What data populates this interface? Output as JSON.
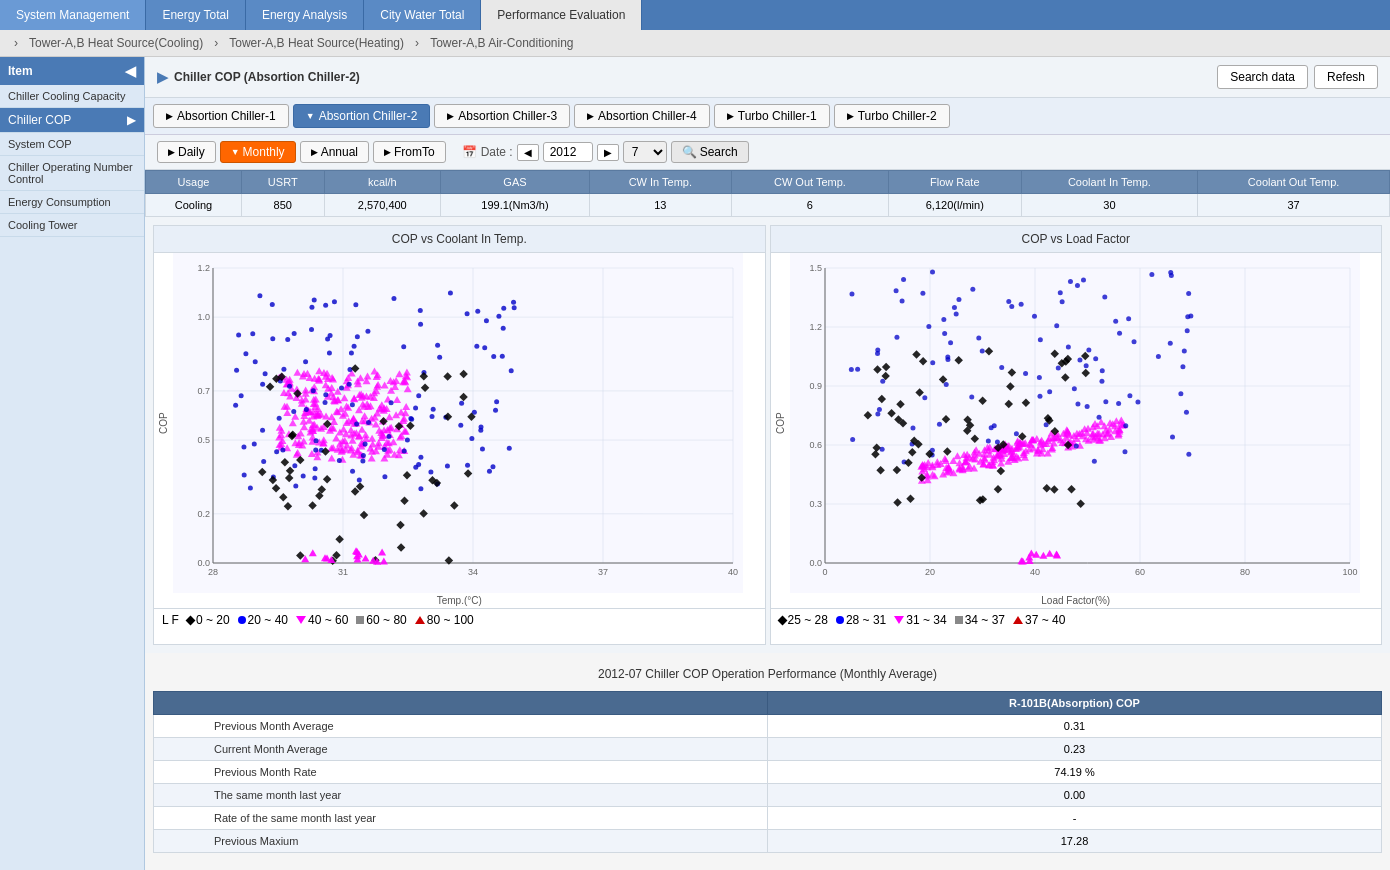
{
  "topNav": {
    "items": [
      {
        "label": "System Management",
        "active": false
      },
      {
        "label": "Energy Total",
        "active": false
      },
      {
        "label": "Energy Analysis",
        "active": false
      },
      {
        "label": "City Water Total",
        "active": false
      },
      {
        "label": "Performance Evaluation",
        "active": true
      }
    ]
  },
  "breadcrumb": {
    "items": [
      "Tower-A,B Heat Source(Cooling)",
      "Tower-A,B Heat Source(Heating)",
      "Tower-A,B Air-Conditioning"
    ]
  },
  "sidebar": {
    "header": "Item",
    "items": [
      {
        "label": "Chiller Cooling Capacity",
        "active": false
      },
      {
        "label": "Chiller COP",
        "active": true
      },
      {
        "label": "System COP",
        "active": false
      },
      {
        "label": "Chiller Operating Number Control",
        "active": false
      },
      {
        "label": "Energy Consumption",
        "active": false
      },
      {
        "label": "Cooling Tower",
        "active": false
      }
    ]
  },
  "sectionTitle": "Chiller COP (Absortion Chiller-2)",
  "headerButtons": {
    "searchData": "Search data",
    "refresh": "Refesh"
  },
  "chillerTabs": [
    {
      "label": "Absortion Chiller-1",
      "active": false
    },
    {
      "label": "Absortion Chiller-2",
      "active": true
    },
    {
      "label": "Absortion Chiller-3",
      "active": false
    },
    {
      "label": "Absortion Chiller-4",
      "active": false
    },
    {
      "label": "Turbo Chiller-1",
      "active": false
    },
    {
      "label": "Turbo Chiller-2",
      "active": false
    }
  ],
  "periodButtons": [
    {
      "label": "Daily",
      "active": false
    },
    {
      "label": "Monthly",
      "active": true
    },
    {
      "label": "Annual",
      "active": false
    },
    {
      "label": "FromTo",
      "active": false
    }
  ],
  "dateControl": {
    "label": "Date :",
    "year": "2012",
    "month": "7",
    "searchLabel": "Search"
  },
  "dataTable": {
    "headers": [
      "Usage",
      "USRT",
      "kcal/h",
      "GAS",
      "CW In Temp.",
      "CW Out Temp.",
      "Flow Rate",
      "Coolant In Temp.",
      "Coolant Out Temp."
    ],
    "row": [
      "Cooling",
      "850",
      "2,570,400",
      "199.1(Nm3/h)",
      "13",
      "6",
      "6,120(l/min)",
      "30",
      "37"
    ]
  },
  "chart1": {
    "title": "COP vs Coolant In Temp.",
    "xLabel": "Temp.(°C)",
    "yLabel": "COP",
    "xMin": 28,
    "xMax": 40,
    "yMin": 0,
    "yMax": 1.2,
    "legend": [
      {
        "label": "0 ~ 20",
        "color": "#000000",
        "shape": "diamond"
      },
      {
        "label": "20 ~ 40",
        "color": "#0000ff",
        "shape": "dot"
      },
      {
        "label": "40 ~ 60",
        "color": "#ff00ff",
        "shape": "triangle-down"
      },
      {
        "label": "60 ~ 80",
        "color": "#808080",
        "shape": "square"
      },
      {
        "label": "80 ~ 100",
        "color": "#cc0000",
        "shape": "triangle-up"
      }
    ],
    "legendPrefix": "L F"
  },
  "chart2": {
    "title": "COP vs Load Factor",
    "xLabel": "Load Factor(%)",
    "yLabel": "COP",
    "xMin": 0,
    "xMax": 100,
    "yMin": 0,
    "yMax": 1.5,
    "legend": [
      {
        "label": "25 ~ 28",
        "color": "#000000",
        "shape": "diamond"
      },
      {
        "label": "28 ~ 31",
        "color": "#0000ff",
        "shape": "dot"
      },
      {
        "label": "31 ~ 34",
        "color": "#ff00ff",
        "shape": "triangle-down"
      },
      {
        "label": "34 ~ 37",
        "color": "#808080",
        "shape": "square"
      },
      {
        "label": "37 ~ 40",
        "color": "#cc0000",
        "shape": "triangle-up"
      }
    ]
  },
  "bottomTable": {
    "title": "2012-07 Chiller COP Operation Performance (Monthly Average)",
    "columnHeader": "R-101B(Absorption) COP",
    "rows": [
      {
        "label": "Previous Month Average",
        "value": "0.31"
      },
      {
        "label": "Current Month Average",
        "value": "0.23"
      },
      {
        "label": "Previous Month Rate",
        "value": "74.19 %"
      },
      {
        "label": "The same month last year",
        "value": "0.00"
      },
      {
        "label": "Rate of the same month last year",
        "value": "-"
      },
      {
        "label": "Previous Maxium",
        "value": "17.28"
      }
    ]
  }
}
